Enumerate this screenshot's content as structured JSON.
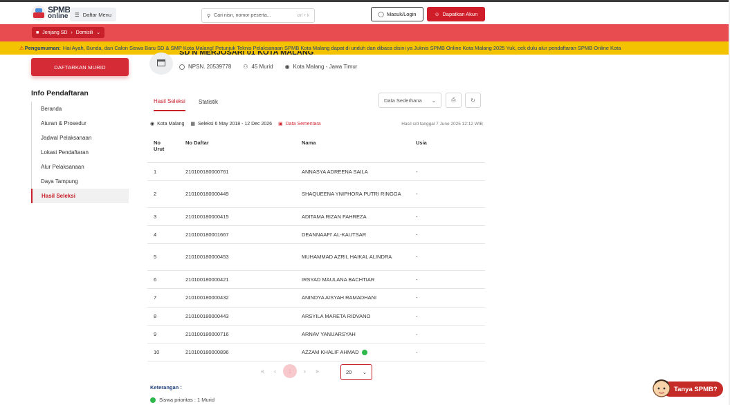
{
  "header": {
    "logo_line1": "SPMB",
    "logo_line2": "online",
    "menu_label": "Daftar Menu",
    "search_placeholder": "Cari nisn, nomor peserta...",
    "search_shortcut": "ctrl + k",
    "login_label": "Masuk/Login",
    "register_label": "Dapatkan Akun"
  },
  "breadcrumb": {
    "level": "Jenjang SD",
    "path": "Domisili"
  },
  "announcement": {
    "label": "Pengumuman:",
    "text": "Hai Ayah, Bunda, dan Calon Siswa Baru SD & SMP Kota Malang!  Petunjuk Teknis Pelaksanaan SPMB Kota Malang dapat di unduh dan dibaca disini ya Juknis SPMB Online Kota Malang 2025   Yuk, cek dulu alur pendaftaran SPMB Online Kota"
  },
  "sidebar": {
    "cta": "DAFTARKAN MURID",
    "title": "Info Pendaftaran",
    "items": [
      {
        "label": "Beranda"
      },
      {
        "label": "Aturan & Prosedur"
      },
      {
        "label": "Jadwal Pelaksanaan"
      },
      {
        "label": "Lokasi Pendaftaran"
      },
      {
        "label": "Alur Pelaksanaan"
      },
      {
        "label": "Daya Tampung"
      },
      {
        "label": "Hasil Seleksi"
      }
    ]
  },
  "school": {
    "name": "SD N MERJOSARI 01 KOTA MALANG",
    "npsn": "NPSN. 20539778",
    "murid": "45 Murid",
    "location": "Kota Malang - Jawa Timur"
  },
  "tabs": [
    {
      "label": "Hasil Seleksi"
    },
    {
      "label": "Statistik"
    }
  ],
  "view_select": "Data Sederhana",
  "filter": {
    "city": "Kota Malang",
    "period": "Seleksi 6 May 2018 - 12 Dec 2026",
    "status": "Data Sementara",
    "updated": "Hasil s/d tanggal 7 June 2025 12:12 WIB"
  },
  "table": {
    "headers": {
      "no_line1": "No",
      "no_line2": "Urut",
      "daftar": "No Daftar",
      "nama": "Nama",
      "usia": "Usia"
    },
    "rows": [
      {
        "no": "1",
        "daftar": "210100180000761",
        "nama": "ANNASYA ADREENA SAILA",
        "usia": "-"
      },
      {
        "no": "2",
        "daftar": "210100180000449",
        "nama": "SHAQUEENA YNIPHORA PUTRI RINGGA",
        "usia": "-"
      },
      {
        "no": "3",
        "daftar": "210100180000415",
        "nama": "ADITAMA RIZAN FAHREZA",
        "usia": "-"
      },
      {
        "no": "4",
        "daftar": "210100180001667",
        "nama": "DEANNAAFI' AL-KAUTSAR",
        "usia": "-"
      },
      {
        "no": "5",
        "daftar": "210100180000453",
        "nama": "MUHAMMAD AZRIL HAIKAL ALINDRA",
        "usia": "-"
      },
      {
        "no": "6",
        "daftar": "210100180000421",
        "nama": "IRSYAD MAULANA BACHTIAR",
        "usia": "-"
      },
      {
        "no": "7",
        "daftar": "210100180000432",
        "nama": "ANINDYA AISYAH RAMADHANI",
        "usia": "-"
      },
      {
        "no": "8",
        "daftar": "210100180000443",
        "nama": "ARSYILA MARETA RIDVANO",
        "usia": "-"
      },
      {
        "no": "9",
        "daftar": "210100180000716",
        "nama": "ARNAV YANUARSYAH",
        "usia": "-"
      },
      {
        "no": "10",
        "daftar": "210100180000896",
        "nama": "AZZAM KHALIF AHMAD",
        "usia": "-"
      }
    ]
  },
  "pager": {
    "first": "«",
    "prev": "‹",
    "current": "1",
    "next": "›",
    "last": "»",
    "page_size": "20"
  },
  "keterangan": {
    "title": "Keterangan :",
    "item": "Siswa prioritas : 1 Murid"
  },
  "chat": {
    "label": "Tanya SPMB?"
  },
  "colors": {
    "brand_red": "#cf1d2a",
    "banner_red": "#e84b50",
    "announce_yellow": "#f3c200",
    "priority_green": "#2db84c"
  }
}
